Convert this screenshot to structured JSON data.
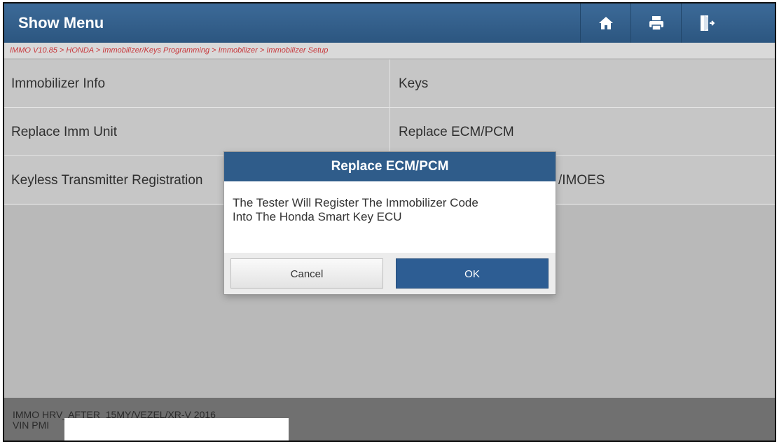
{
  "header": {
    "title": "Show Menu",
    "icons": [
      "home-icon",
      "print-icon",
      "exit-icon"
    ]
  },
  "breadcrumb": "IMMO V10.85 > HONDA > Immobilizer/Keys Programming > Immobilizer > Immobilizer Setup",
  "menu": {
    "items": [
      {
        "label": "Immobilizer Info"
      },
      {
        "label": "Keys"
      },
      {
        "label": "Replace Imm Unit"
      },
      {
        "label": "Replace ECM/PCM"
      },
      {
        "label": "Keyless Transmitter Registration"
      },
      {
        "label": "/IMOES"
      }
    ]
  },
  "dialog": {
    "title": "Replace ECM/PCM",
    "message_line1": "The Tester Will Register The Immobilizer Code",
    "message_line2": "Into The Honda Smart Key ECU",
    "cancel_label": "Cancel",
    "ok_label": "OK"
  },
  "footer": {
    "vehicle": "IMMO HRV_AFTER_15MY/VEZEL/XR-V 2016",
    "vin_label": "VIN PMI"
  },
  "colors": {
    "header_bg": "#2f5c8a",
    "breadcrumb_text": "#c8383c",
    "ok_button": "#2d5d93"
  }
}
